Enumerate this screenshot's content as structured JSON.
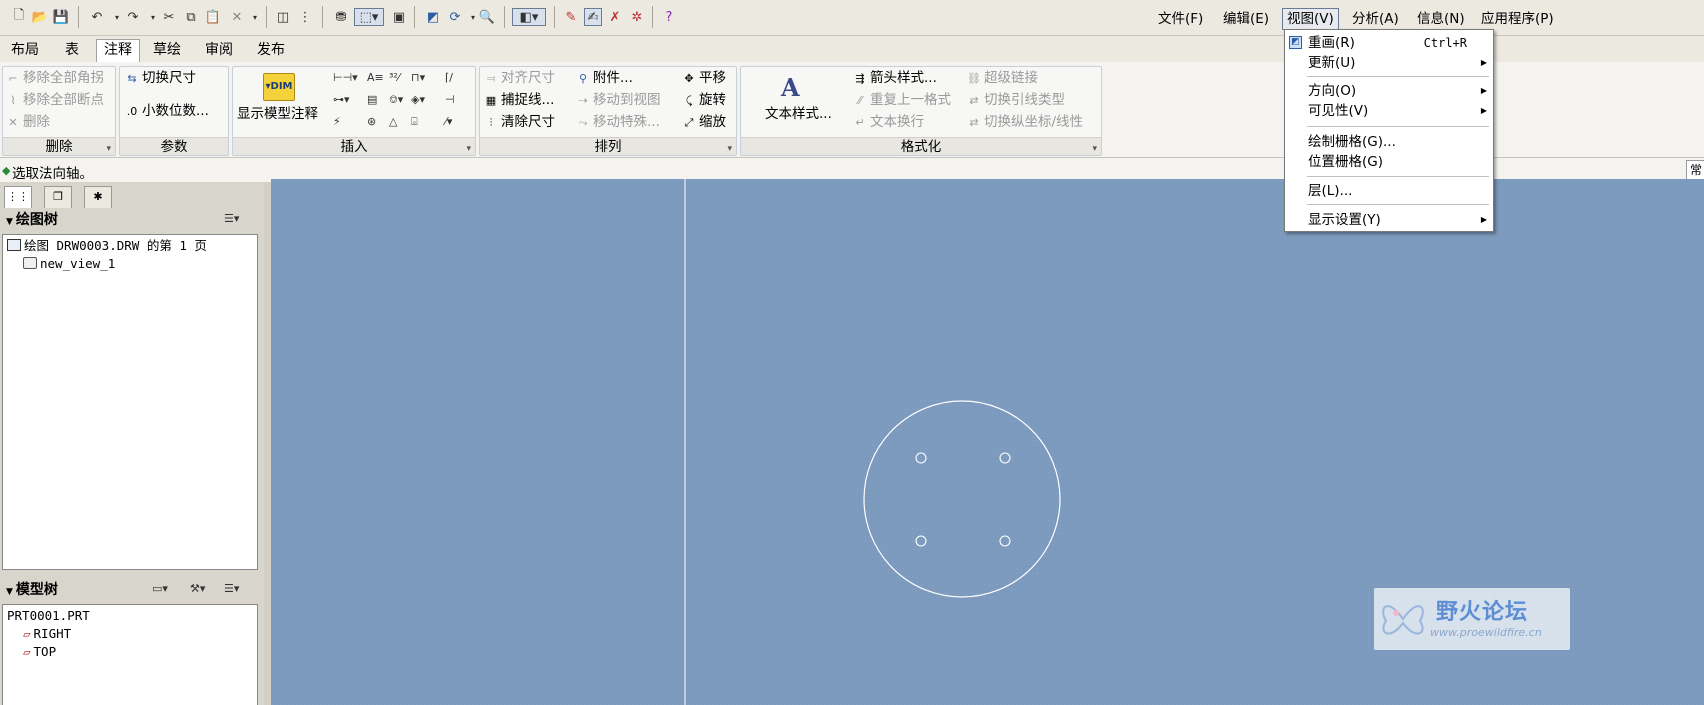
{
  "menubar": {
    "items": [
      "文件(F)",
      "编辑(E)",
      "视图(V)",
      "分析(A)",
      "信息(N)",
      "应用程序(P)"
    ],
    "active_index": 2
  },
  "ribbon": {
    "tabs": [
      "布局",
      "表",
      "注释",
      "草绘",
      "审阅",
      "发布"
    ],
    "active_tab_index": 2,
    "groups": {
      "delete": {
        "title": "删除",
        "buttons": [
          "移除全部角拐",
          "移除全部断点",
          "删除"
        ]
      },
      "params": {
        "title": "参数",
        "buttons": [
          "切换尺寸",
          "小数位数..."
        ]
      },
      "insert": {
        "title": "插入",
        "big_button": "显示模型注释"
      },
      "arrange": {
        "title": "排列",
        "buttons": [
          "对齐尺寸",
          "捕捉线...",
          "清除尺寸",
          "附件...",
          "移动到视图",
          "移动特殊...",
          "平移",
          "旋转",
          "缩放"
        ]
      },
      "format": {
        "title": "格式化",
        "big_button": "文本样式...",
        "buttons": [
          "箭头样式...",
          "重复上一格式",
          "文本换行",
          "超级链接",
          "切换引线类型",
          "切换纵坐标/线性"
        ]
      }
    }
  },
  "status": {
    "message": "选取法向轴。",
    "right_button": "常"
  },
  "drawing_tree": {
    "title": "绘图树",
    "root": "绘图 DRW0003.DRW 的第 1 页",
    "children": [
      "new_view_1"
    ]
  },
  "model_tree": {
    "title": "模型树",
    "root": "PRT0001.PRT",
    "children": [
      "RIGHT",
      "TOP"
    ]
  },
  "view_menu": {
    "items": [
      {
        "label": "重画(R)",
        "accelerator": "Ctrl+R",
        "submenu": false,
        "icon": "repaint-icon"
      },
      {
        "label": "更新(U)",
        "accelerator": "",
        "submenu": true
      },
      {
        "label": "方向(O)",
        "accelerator": "",
        "submenu": true
      },
      {
        "label": "可见性(V)",
        "accelerator": "",
        "submenu": true
      },
      {
        "label": "绘制栅格(G)...",
        "accelerator": "",
        "submenu": false
      },
      {
        "label": "位置栅格(G)",
        "accelerator": "",
        "submenu": false
      },
      {
        "label": "层(L)...",
        "accelerator": "",
        "submenu": false
      },
      {
        "label": "显示设置(Y)",
        "accelerator": "",
        "submenu": true
      }
    ]
  },
  "watermark": {
    "title": "野火论坛",
    "url": "www.proewildfire.cn"
  },
  "colors": {
    "canvas_bg": "#7c9abd",
    "geometry": "#ffffff",
    "watermark": "#5d8ed4"
  }
}
